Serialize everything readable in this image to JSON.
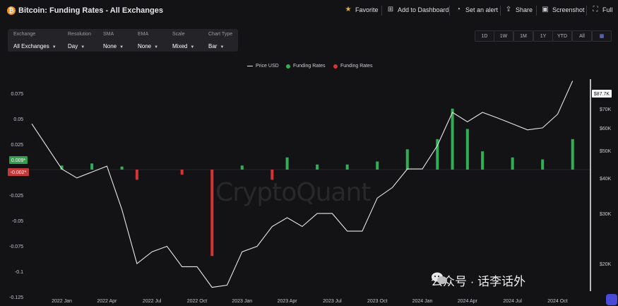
{
  "header": {
    "coin_symbol": "₿",
    "title": "Bitcoin: Funding Rates - All Exchanges",
    "favorite": "Favorite",
    "add_dashboard": "Add to Dashboard",
    "set_alert": "Set an alert",
    "share": "Share",
    "screenshot": "Screenshot",
    "full": "Full"
  },
  "controls": [
    {
      "label": "Exchange",
      "value": "All Exchanges"
    },
    {
      "label": "Resolution",
      "value": "Day"
    },
    {
      "label": "SMA",
      "value": "None"
    },
    {
      "label": "EMA",
      "value": "None"
    },
    {
      "label": "Scale",
      "value": "Mixed"
    },
    {
      "label": "Chart Type",
      "value": "Bar"
    }
  ],
  "ranges": [
    "1D",
    "1W",
    "1M",
    "1Y",
    "YTD",
    "All"
  ],
  "legend": {
    "price": "Price USD",
    "pos": "Funding Rates",
    "neg": "Funding Rates"
  },
  "watermark": "CryptoQuant",
  "overlay_caption": "公众号 · 话李话外",
  "colors": {
    "pos": "#2fb055",
    "neg": "#d43434",
    "price": "#e8e8e8",
    "bg": "#131316",
    "current_pos_tag": "#2fa04c",
    "current_neg_tag": "#c33a3a"
  },
  "chart_data": {
    "type": "bar",
    "x_ticks": [
      "2022 Jan",
      "2022 Apr",
      "2022 Jul",
      "2022 Oct",
      "2023 Jan",
      "2023 Apr",
      "2023 Jul",
      "2023 Oct",
      "2024 Jan",
      "2024 Apr",
      "2024 Jul",
      "2024 Oct"
    ],
    "left_axis": {
      "ticks": [
        "0.075",
        "0.05",
        "0.025",
        "0",
        "-0.025",
        "-0.05",
        "-0.075",
        "-0.1",
        "-0.125"
      ],
      "ylim": [
        -0.125,
        0.085
      ]
    },
    "right_axis": {
      "ticks": [
        "$80K",
        "$70K",
        "$60K",
        "$50K",
        "$40K",
        "$30K",
        "$20K"
      ],
      "scale": "log"
    },
    "current_tags": {
      "funding_pos": "0.009*",
      "funding_neg": "-0.002*",
      "price": "$87.7K"
    },
    "series": [
      {
        "name": "Price USD",
        "type": "line",
        "x": [
          "2021-11",
          "2022-01",
          "2022-02",
          "2022-04",
          "2022-05",
          "2022-06",
          "2022-07",
          "2022-08",
          "2022-09",
          "2022-10",
          "2022-11",
          "2022-12",
          "2023-01",
          "2023-02",
          "2023-03",
          "2023-04",
          "2023-05",
          "2023-06",
          "2023-07",
          "2023-08",
          "2023-09",
          "2023-10",
          "2023-11",
          "2023-12",
          "2024-01",
          "2024-02",
          "2024-03",
          "2024-04",
          "2024-05",
          "2024-06",
          "2024-07",
          "2024-08",
          "2024-09",
          "2024-10",
          "2024-11"
        ],
        "values": [
          62,
          43,
          40,
          44,
          31,
          20,
          22,
          23,
          19.5,
          19.5,
          16.5,
          16.8,
          22,
          23,
          27,
          29,
          27,
          30,
          30,
          26,
          26,
          34,
          37,
          43,
          43,
          52,
          68,
          63,
          68,
          65,
          62,
          59,
          60,
          67,
          87.7
        ]
      },
      {
        "name": "Funding Rates",
        "type": "bar",
        "x": [
          "2022-01",
          "2022-03",
          "2022-05",
          "2022-06",
          "2022-09",
          "2022-11",
          "2023-01",
          "2023-03",
          "2023-04",
          "2023-06",
          "2023-08",
          "2023-10",
          "2023-12",
          "2024-02",
          "2024-03",
          "2024-04",
          "2024-05",
          "2024-07",
          "2024-09",
          "2024-11"
        ],
        "values": [
          0.004,
          0.006,
          0.003,
          -0.01,
          -0.005,
          -0.085,
          0.004,
          -0.01,
          0.012,
          0.005,
          0.005,
          0.008,
          0.02,
          0.03,
          0.06,
          0.04,
          0.018,
          0.012,
          0.01,
          0.03
        ]
      }
    ]
  }
}
